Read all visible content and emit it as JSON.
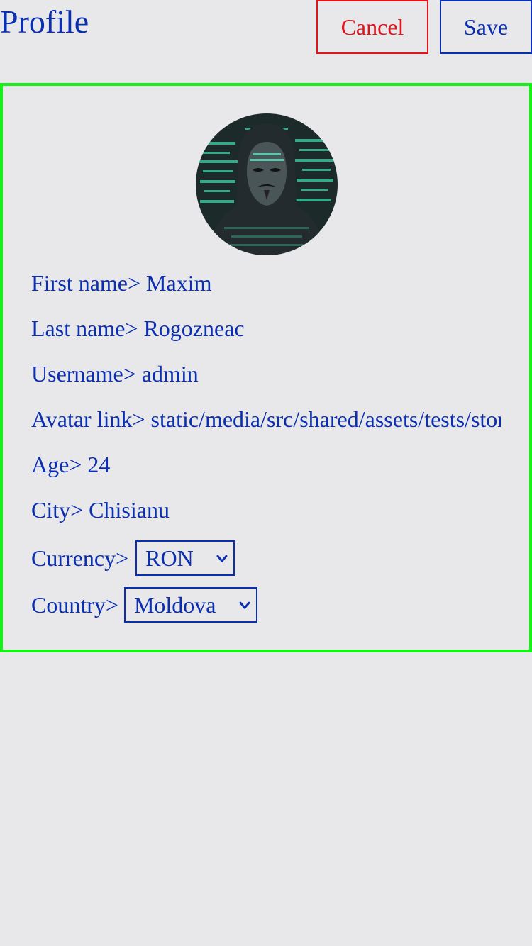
{
  "header": {
    "title": "Profile",
    "cancel_label": "Cancel",
    "save_label": "Save"
  },
  "profile": {
    "avatar_icon": "avatar-photo",
    "fields": {
      "first_name": {
        "label": "First name>",
        "value": "Maxim"
      },
      "last_name": {
        "label": "Last name>",
        "value": "Rogozneac"
      },
      "username": {
        "label": "Username>",
        "value": "admin"
      },
      "avatar_link": {
        "label": "Avatar link>",
        "value": "static/media/src/shared/assets/tests/stor"
      },
      "age": {
        "label": "Age>",
        "value": "24"
      },
      "city": {
        "label": "City>",
        "value": "Chisianu"
      },
      "currency": {
        "label": "Currency>",
        "selected": "RON"
      },
      "country": {
        "label": "Country>",
        "selected": "Moldova"
      }
    }
  },
  "colors": {
    "accent": "#0a2fb0",
    "cancel": "#e0141a",
    "card_border": "#19f019",
    "background": "#e8e8ea"
  }
}
